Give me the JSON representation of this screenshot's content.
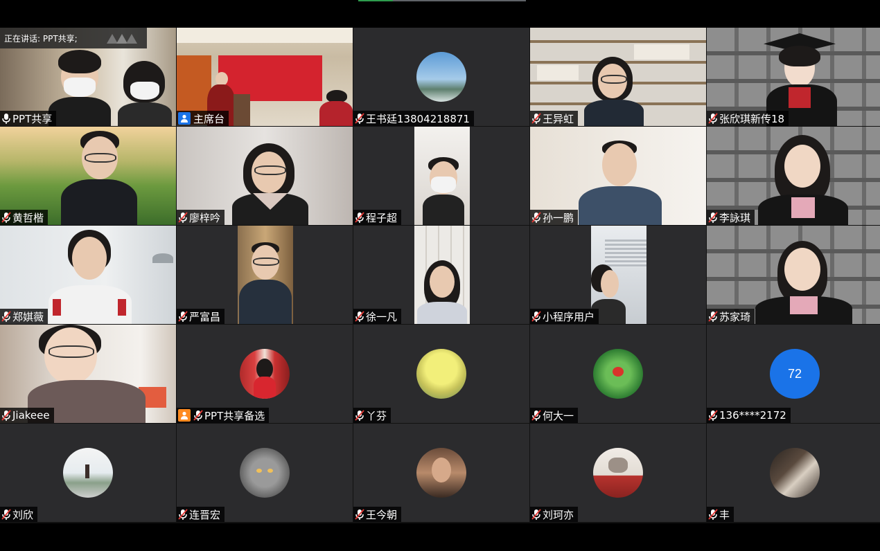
{
  "speaking_banner": "正在讲话: PPT共享;",
  "colors": {
    "talking": "#35b05a",
    "host_blue": "#1a73e8",
    "host_orange": "#ff8a1f",
    "numeric_avatar": "#1a73e8"
  },
  "participants": [
    {
      "name": "PPT共享",
      "mic": "mic-on-icon"
    },
    {
      "name": "主席台",
      "mic": "host-icon"
    },
    {
      "name": "王书廷13804218871",
      "mic": "mic-muted-icon"
    },
    {
      "name": "王异虹",
      "mic": "mic-muted-icon"
    },
    {
      "name": "张欣琪新传18",
      "mic": "mic-muted-icon"
    },
    {
      "name": "黄哲楷",
      "mic": "mic-muted-icon"
    },
    {
      "name": "廖梓吟",
      "mic": "mic-muted-icon"
    },
    {
      "name": "程子超",
      "mic": "mic-muted-icon"
    },
    {
      "name": "孙一鹏",
      "mic": "mic-muted-icon"
    },
    {
      "name": "李詠琪",
      "mic": "mic-muted-icon"
    },
    {
      "name": "郑娸薇",
      "mic": "mic-muted-icon"
    },
    {
      "name": "严富昌",
      "mic": "mic-muted-icon"
    },
    {
      "name": "徐一凡",
      "mic": "mic-muted-icon"
    },
    {
      "name": "小程序用户",
      "mic": "mic-muted-icon"
    },
    {
      "name": "苏家琦",
      "mic": "mic-muted-icon"
    },
    {
      "name": "Jiakeee",
      "mic": "mic-muted-icon"
    },
    {
      "name": "PPT共享备选",
      "mic": "mic-muted-icon"
    },
    {
      "name": "丫芬",
      "mic": "mic-muted-icon"
    },
    {
      "name": "何大一",
      "mic": "mic-muted-icon"
    },
    {
      "name": "136****2172",
      "mic": "mic-muted-icon",
      "avatar_text": "72"
    },
    {
      "name": "刘欣",
      "mic": "mic-muted-icon"
    },
    {
      "name": "连晋宏",
      "mic": "mic-muted-icon"
    },
    {
      "name": "王今朝",
      "mic": "mic-muted-icon"
    },
    {
      "name": "刘珂亦",
      "mic": "mic-muted-icon"
    },
    {
      "name": "丰",
      "mic": "mic-muted-icon"
    }
  ]
}
